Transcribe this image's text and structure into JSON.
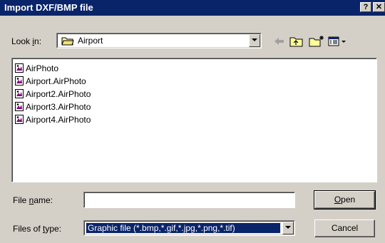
{
  "window": {
    "title": "Import DXF/BMP file",
    "help_button": "?",
    "close_button": "✕"
  },
  "lookin": {
    "label_pre": "Look ",
    "label_ul": "i",
    "label_post": "n:",
    "value": "Airport"
  },
  "files": [
    {
      "name": "AirPhoto"
    },
    {
      "name": "Airport.AirPhoto"
    },
    {
      "name": "Airport2.AirPhoto"
    },
    {
      "name": "Airport3.AirPhoto"
    },
    {
      "name": "Airport4.AirPhoto"
    }
  ],
  "filename": {
    "label_pre": "File ",
    "label_ul": "n",
    "label_post": "ame:",
    "value": "",
    "placeholder": ""
  },
  "filetype": {
    "label_pre": "Files of ",
    "label_ul": "t",
    "label_post": "ype:",
    "value": "Graphic file (*.bmp,*.gif,*.jpg,*.png,*.tif)"
  },
  "buttons": {
    "open_ul": "O",
    "open_rest": "pen",
    "cancel": "Cancel"
  },
  "colors": {
    "titlebar": "#0a246a",
    "dialog_bg": "#d4d0c8",
    "selection": "#0a246a"
  },
  "icons": {
    "back": "back-arrow-icon",
    "up": "up-folder-icon",
    "newfolder": "new-folder-icon",
    "view": "view-menu-icon"
  }
}
